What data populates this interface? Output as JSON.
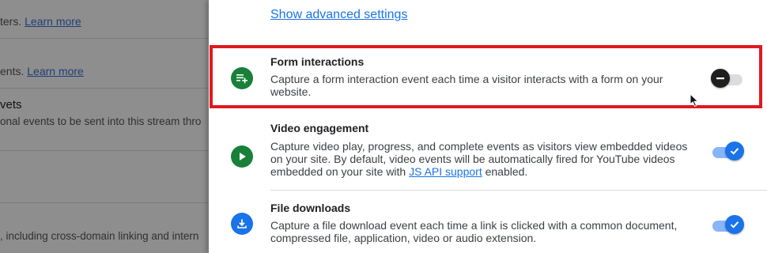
{
  "background": {
    "line1_text": "ters.",
    "line1_link": "Learn more",
    "line2_text": "ents.",
    "line2_link": "Learn more",
    "heading": "vets",
    "line3_text": "onal events to be sent into this stream thro",
    "line4_text": ", including cross-domain linking and intern"
  },
  "panel": {
    "advanced_link": "Show advanced settings",
    "settings": [
      {
        "title": "Form interactions",
        "description": "Capture a form interaction event each time a visitor interacts with a form on your website.",
        "icon": "form-add-icon",
        "icon_color": "#188038",
        "enabled": false
      },
      {
        "title": "Video engagement",
        "description_before_link": "Capture video play, progress, and complete events as visitors view embedded videos on your site. By default, video events will be automatically fired for YouTube videos embedded on your site with ",
        "description_link": "JS API support",
        "description_after_link": " enabled.",
        "icon": "play-icon",
        "icon_color": "#188038",
        "enabled": true
      },
      {
        "title": "File downloads",
        "description": "Capture a file download event each time a link is clicked with a common document, compressed file, application, video or audio extension.",
        "icon": "download-icon",
        "icon_color": "#1a73e8",
        "enabled": true
      }
    ]
  },
  "colors": {
    "highlight": "#e0191f",
    "accent": "#1a73e8",
    "green": "#188038"
  }
}
